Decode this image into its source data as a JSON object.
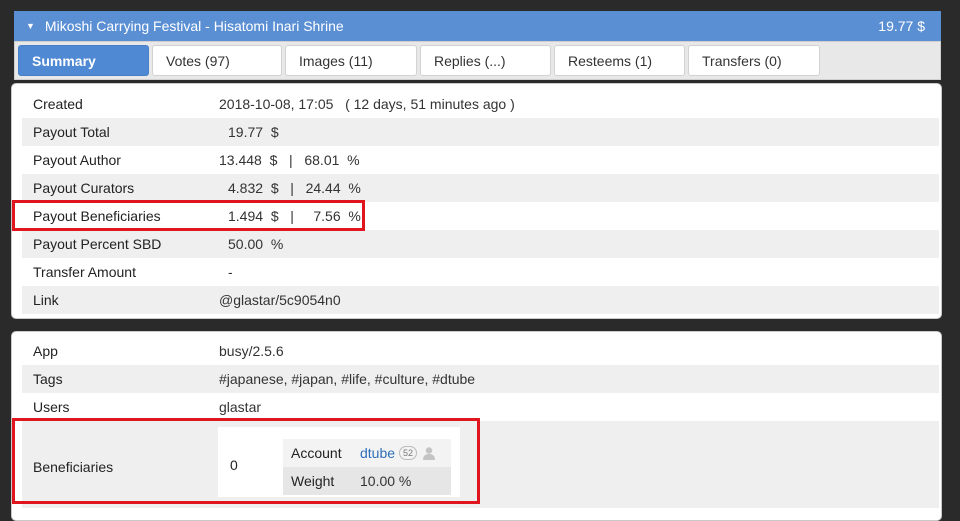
{
  "header": {
    "title": "Mikoshi Carrying Festival - Hisatomi Inari Shrine",
    "amount": "19.77 $"
  },
  "tabs": [
    {
      "label": "Summary",
      "active": true
    },
    {
      "label": "Votes (97)"
    },
    {
      "label": "Images (11)"
    },
    {
      "label": "Replies (...)"
    },
    {
      "label": "Resteems (1)"
    },
    {
      "label": "Transfers (0)"
    }
  ],
  "summary": {
    "created_label": "Created",
    "created_value": "2018-10-08, 17:05   ( 12 days, 51 minutes ago )",
    "payout_total_label": "Payout Total",
    "payout_total_value": "19.77  $",
    "payout_author_label": "Payout Author",
    "payout_author_value": "13.448  $   |   68.01  %",
    "payout_curators_label": "Payout Curators",
    "payout_curators_value": "4.832  $   |   24.44  %",
    "payout_beneficiaries_label": "Payout Beneficiaries",
    "payout_beneficiaries_value": "1.494  $   |     7.56  %",
    "payout_percent_label": "Payout Percent SBD",
    "payout_percent_value": "50.00  %",
    "transfer_label": "Transfer Amount",
    "transfer_value": "-",
    "link_label": "Link",
    "link_value": "@glastar/5c9054n0"
  },
  "meta": {
    "app_label": "App",
    "app_value": "busy/2.5.6",
    "tags_label": "Tags",
    "tags_value": "#japanese, #japan, #life, #culture, #dtube",
    "users_label": "Users",
    "users_value": "glastar",
    "beneficiaries_label": "Beneficiaries",
    "beneficiary_index": "0",
    "account_label": "Account",
    "account_value": "dtube",
    "account_badge": "52",
    "weight_label": "Weight",
    "weight_value": "10.00 %"
  },
  "colors": {
    "accent": "#5b8fd4",
    "active_tab": "#4f88d3",
    "link": "#2f6fb8",
    "highlight": "#e0161e"
  }
}
